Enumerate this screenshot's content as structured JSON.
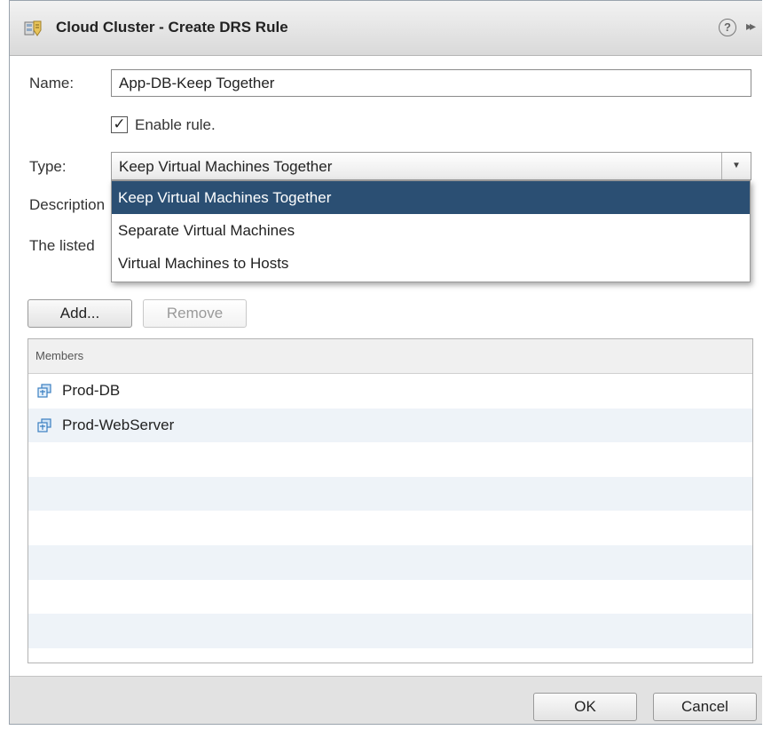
{
  "window": {
    "title": "Cloud Cluster - Create DRS Rule",
    "help_icon": "?",
    "expand_icon": "▸▸"
  },
  "form": {
    "name_label": "Name:",
    "name_value": "App-DB-Keep Together",
    "enable_label": "Enable rule.",
    "enable_checked": true,
    "type_label": "Type:",
    "type_value": "Keep Virtual Machines Together",
    "description_label": "Description",
    "listed_label": "The listed"
  },
  "type_options": [
    {
      "label": "Keep Virtual Machines Together",
      "selected": true
    },
    {
      "label": "Separate Virtual Machines",
      "selected": false
    },
    {
      "label": "Virtual Machines to Hosts",
      "selected": false
    }
  ],
  "buttons": {
    "add": "Add...",
    "remove": "Remove",
    "ok": "OK",
    "cancel": "Cancel"
  },
  "members": {
    "header": "Members",
    "items": [
      "Prod-DB",
      "Prod-WebServer"
    ]
  },
  "colors": {
    "selection": "#2b4f73",
    "row_alt": "#eef3f8",
    "icon_blue": "#3a7fc1"
  }
}
